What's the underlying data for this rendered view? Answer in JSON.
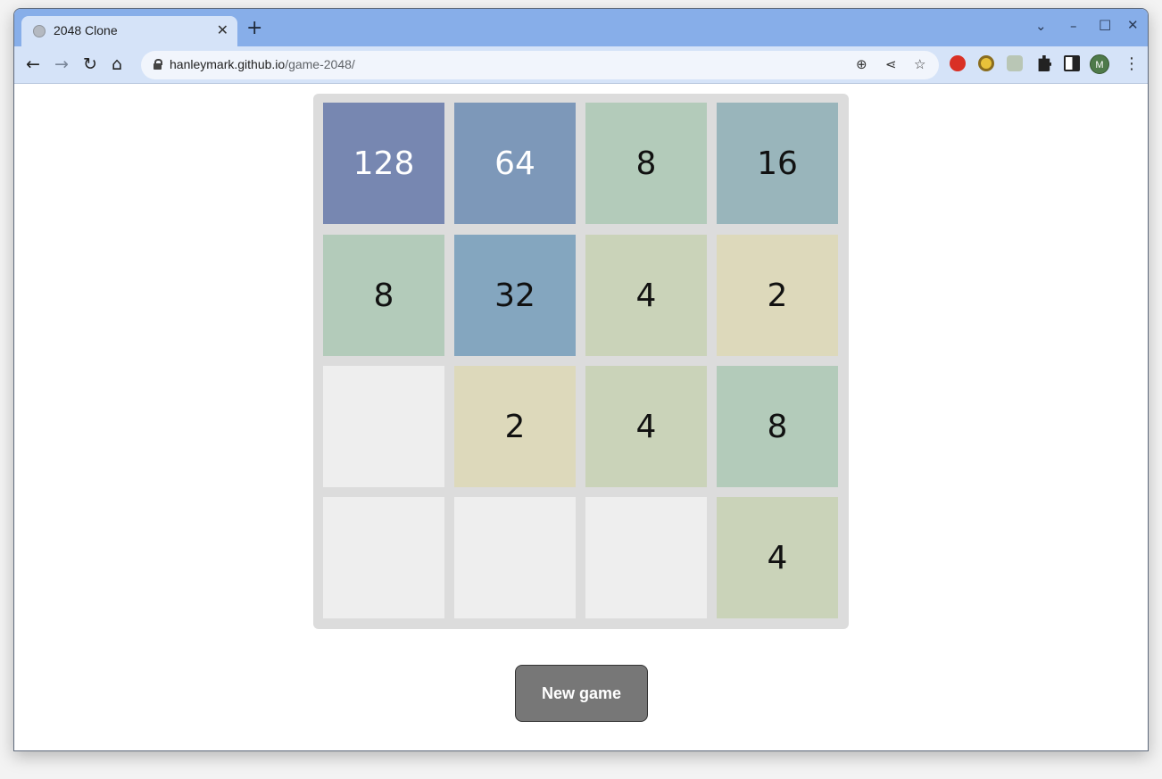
{
  "browser": {
    "tab_title": "2048 Clone",
    "tab_close": "✕",
    "new_tab": "+",
    "url_host": "hanleymark.github.io",
    "url_path": "/game-2048/",
    "avatar_letter": "M",
    "window_controls": {
      "dropdown": "⌄",
      "minimize": "–",
      "maximize": "□",
      "close": "✕"
    },
    "nav": {
      "back": "←",
      "forward": "→",
      "reload": "↻",
      "home": "⌂"
    },
    "omnibox_icons": {
      "zoom": "⊕",
      "share": "⋖",
      "bookmark": "☆"
    },
    "menu": "⋮"
  },
  "game": {
    "tiles": [
      [
        "128",
        "64",
        "8",
        "16"
      ],
      [
        "8",
        "32",
        "4",
        "2"
      ],
      [
        "",
        "2",
        "4",
        "8"
      ],
      [
        "",
        "",
        "",
        "4"
      ]
    ],
    "colors": {
      "empty": "#eeeeee",
      "2": "#ddd9bb",
      "4": "#cad3b9",
      "8": "#b3cbba",
      "16": "#99b5bb",
      "32": "#84a6bf",
      "64": "#7d98b9",
      "128": "#7787b1"
    },
    "light_text_values": [
      "64",
      "128"
    ],
    "new_game_label": "New game"
  }
}
